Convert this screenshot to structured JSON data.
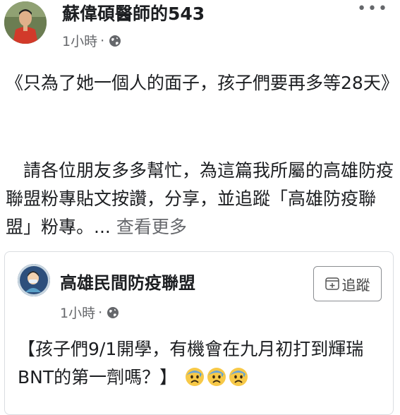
{
  "post": {
    "author": "蘇偉碩醫師的543",
    "timestamp": "1小時",
    "separator": "·",
    "privacy_icon": "globe-icon",
    "more_icon": "more-options-icon",
    "more_label": "•••",
    "paragraph1": "《只為了她一個人的面子，孩子們要再多等28天》",
    "paragraph2": "　請各位朋友多多幫忙，為這篇我所屬的高雄防疫聯盟粉專貼文按讚，分享，並追蹤「高雄防疫聯盟」粉專。",
    "ellipsis": "...",
    "see_more": "查看更多"
  },
  "shared": {
    "page_name": "高雄民間防疫聯盟",
    "timestamp": "1小時",
    "separator": "·",
    "follow_label": "追蹤",
    "follow_icon": "follow-plus-icon",
    "text": "【孩子們9/1開學，有機會在九月初打到輝瑞BNT的第一劑嗎？】",
    "emojis": [
      "anxious-face-emoji",
      "anxious-face-emoji",
      "anxious-face-emoji"
    ]
  },
  "colors": {
    "text": "#1c1e21",
    "secondary": "#65676b",
    "border": "#dadde1"
  }
}
